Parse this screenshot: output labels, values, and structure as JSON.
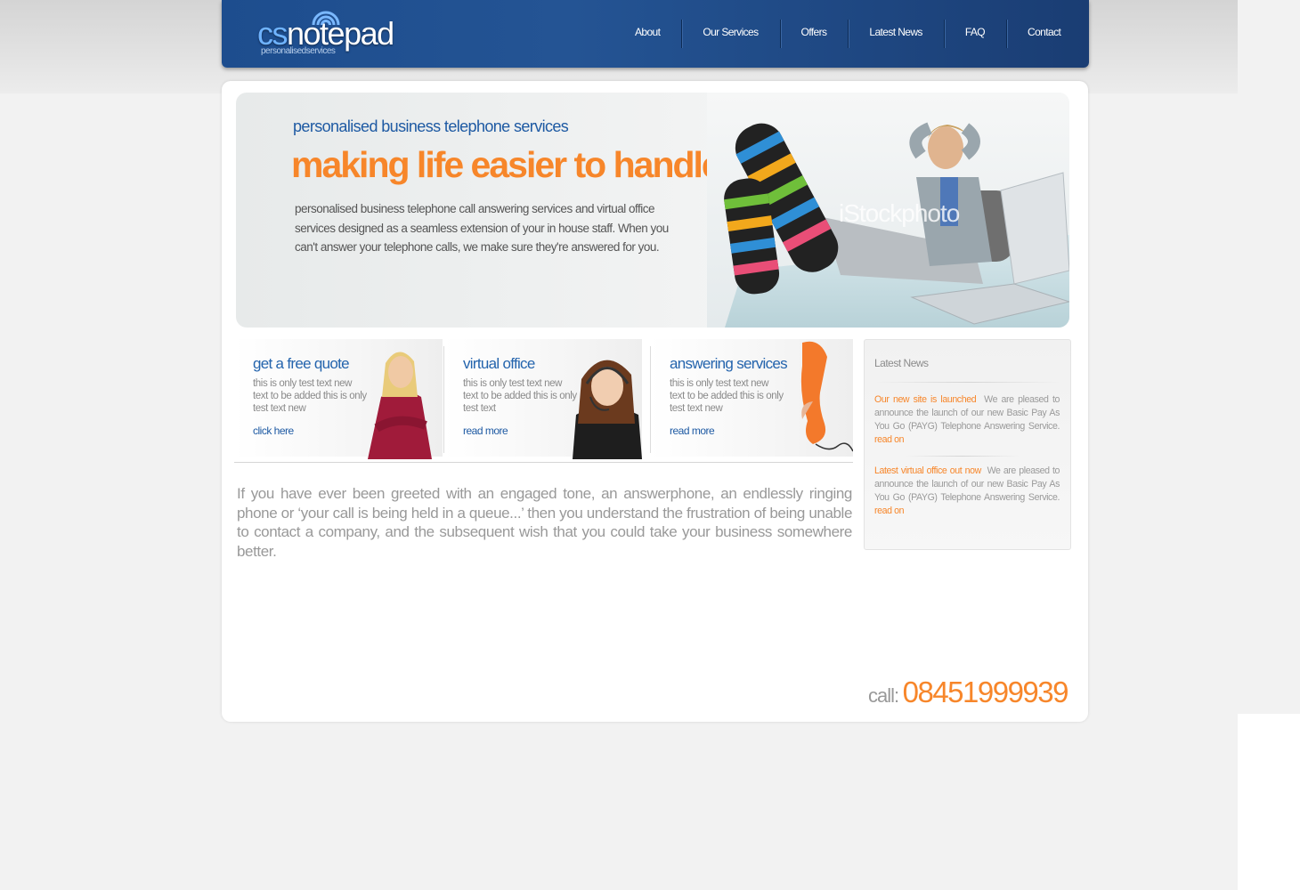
{
  "header": {
    "logo": {
      "part1": "cs",
      "part2": "notepad",
      "tagline": "personalisedservices"
    },
    "nav": [
      "About",
      "Our Services",
      "Offers",
      "Latest News",
      "FAQ",
      "Contact"
    ]
  },
  "hero": {
    "subtitle": "personalised business telephone services",
    "title": "making life easier to handle",
    "description": "personalised business telephone call answering services and virtual office services designed as a seamless extension of your in house staff. When you can't answer your telephone calls, we make sure they're answered for you.",
    "watermark": "iStockphoto"
  },
  "features": [
    {
      "title": "get a free quote",
      "text": "this is only test text  new text to be added this is only test text  new",
      "link": "click here"
    },
    {
      "title": "virtual office",
      "text": "this is only test text  new text to be added this is only test text",
      "link": "read more"
    },
    {
      "title": "answering services",
      "text": "this is only test text  new text to be added this is only test text  new",
      "link": "read more"
    }
  ],
  "news": {
    "title": "Latest News",
    "items": [
      {
        "headline": "Our new site is launched",
        "body": "We are pleased to announce the launch of our new Basic Pay As You Go (PAYG) Telephone Answering Service.",
        "more": "read on"
      },
      {
        "headline": "Latest virtual office out now",
        "body": "We are pleased to announce the launch of our new Basic Pay As You Go (PAYG) Telephone Answering Service.",
        "more": "read on"
      }
    ]
  },
  "intro": "If you have ever been greeted with an engaged tone, an answerphone, an endlessly ringing phone or ‘your call is being held in a queue...’ then you understand the frustration of being unable to contact a company, and the subsequent wish that you could take your business somewhere better.",
  "call": {
    "label": "call:",
    "number": "08451999939"
  },
  "colors": {
    "brand_blue": "#1e5aa3",
    "accent_orange": "#f7862a",
    "header_bg": "#1d4d8e"
  }
}
